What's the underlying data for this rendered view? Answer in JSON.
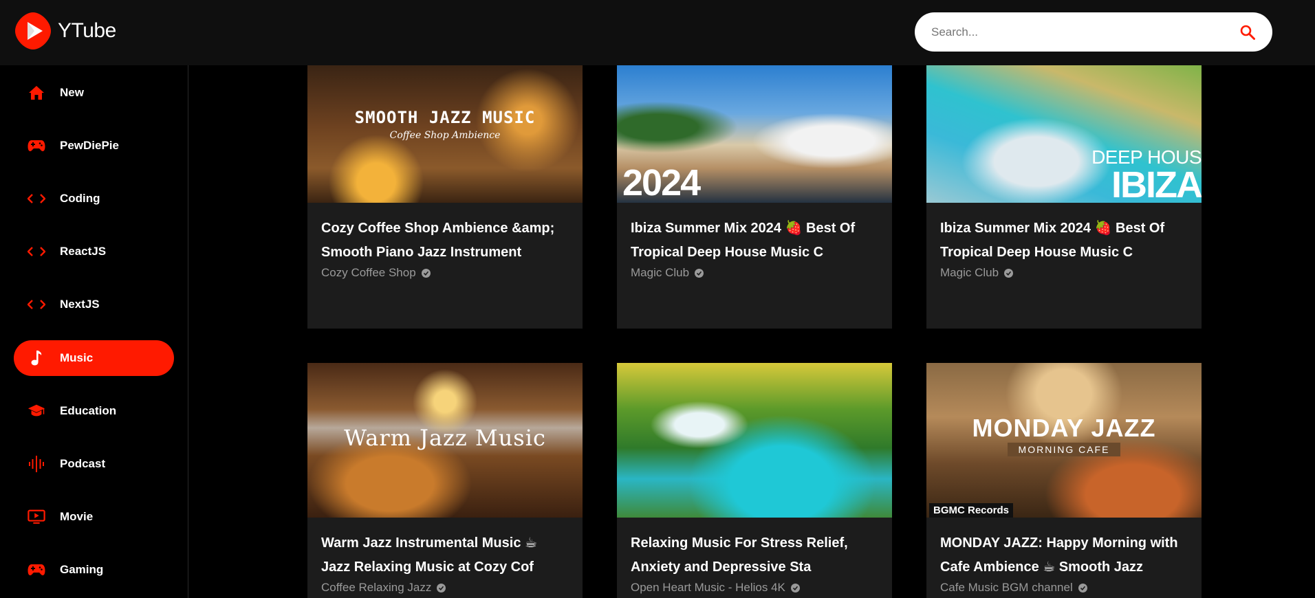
{
  "app": {
    "name": "YTube"
  },
  "search": {
    "placeholder": "Search..."
  },
  "sidebar": {
    "items": [
      {
        "label": "New",
        "icon": "home-icon",
        "active": false
      },
      {
        "label": "PewDiePie",
        "icon": "gamepad-icon",
        "active": false
      },
      {
        "label": "Coding",
        "icon": "code-icon",
        "active": false
      },
      {
        "label": "ReactJS",
        "icon": "code-icon",
        "active": false
      },
      {
        "label": "NextJS",
        "icon": "code-icon",
        "active": false
      },
      {
        "label": "Music",
        "icon": "music-note-icon",
        "active": true
      },
      {
        "label": "Education",
        "icon": "graduation-cap-icon",
        "active": false
      },
      {
        "label": "Podcast",
        "icon": "podcast-icon",
        "active": false
      },
      {
        "label": "Movie",
        "icon": "tv-icon",
        "active": false
      },
      {
        "label": "Gaming",
        "icon": "gamepad-icon",
        "active": false
      }
    ]
  },
  "colors": {
    "accent": "#ff1a00",
    "background": "#000000",
    "card": "#1c1c1c",
    "header": "#0f0f0f"
  },
  "videos": [
    {
      "title": "Cozy Coffee Shop Ambience &amp; Smooth Piano Jazz Instrument",
      "channel": "Cozy Coffee Shop",
      "thumb_text": "SMOOTH JAZZ MUSIC",
      "thumb_subtext": "Coffee Shop Ambience"
    },
    {
      "title": "Ibiza Summer Mix 2024 🍓 Best Of Tropical Deep House Music C",
      "channel": "Magic Club",
      "thumb_text": "2024"
    },
    {
      "title": "Ibiza Summer Mix 2024 🍓 Best Of Tropical Deep House Music C",
      "channel": "Magic Club",
      "thumb_text": "DEEP HOUS",
      "thumb_subtext": "IBIZA"
    },
    {
      "title": "Warm Jazz Instrumental Music ☕ Jazz Relaxing Music at Cozy Cof",
      "channel": "Coffee Relaxing Jazz",
      "thumb_text": "Warm Jazz Music"
    },
    {
      "title": "Relaxing Music For Stress Relief, Anxiety and Depressive Sta",
      "channel": "Open Heart Music - Helios 4K"
    },
    {
      "title": "MONDAY JAZZ: Happy Morning with Cafe Ambience ☕ Smooth Jazz",
      "channel": "Cafe Music BGM channel",
      "thumb_text": "MONDAY JAZZ",
      "thumb_subtext": "MORNING CAFE",
      "thumb_badge": "BGMC Records"
    }
  ]
}
